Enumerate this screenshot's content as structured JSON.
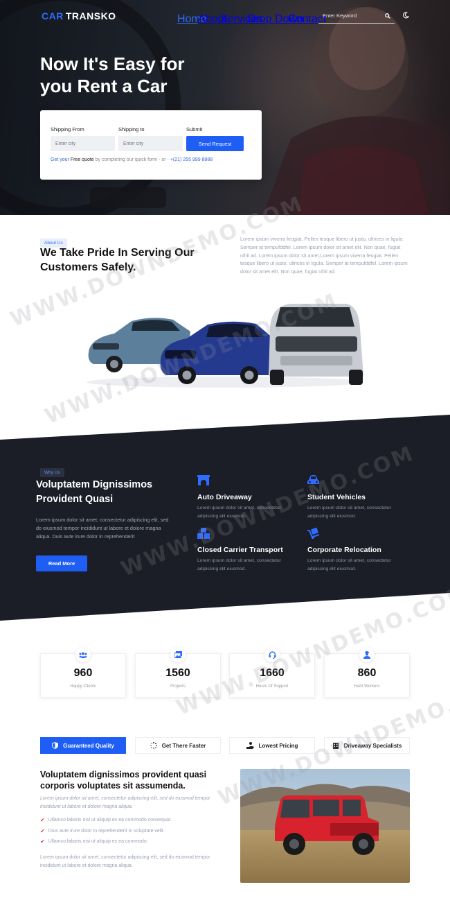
{
  "brand": {
    "mark": "CAR",
    "name": "TRANSKO"
  },
  "nav": {
    "items": [
      "Home",
      "About",
      "Services",
      "Drop Down",
      "Contact"
    ],
    "active_color": "#2f6bff"
  },
  "search": {
    "placeholder": "Enter Keyword"
  },
  "hero": {
    "title": "Now It's Easy for you Rent a Car",
    "form": {
      "from_label": "Shipping From",
      "from_placeholder": "Enter city",
      "to_label": "Shipping to",
      "to_placeholder": "Enter city",
      "submit_label": "Submit",
      "button": "Send Request",
      "note_prefix": "Get your",
      "note_free": "Free",
      "note_quote": "quote",
      "note_middle": "by completing our quick form - or -",
      "phone": "+(21) 255 999 8888"
    }
  },
  "about": {
    "tag": "About Us",
    "title": "We Take Pride In Serving Our Customers Safely.",
    "text": "Lorem ipsum viverra feugiat. Pellen tesque libero ut justo, ultrices in ligula. Semper at tempufddfel. Lorem ipsum dolor sit amet elit. Non quae, fugiat nihil ad. Lorem ipsum dolor sit amet.Lorem ipsum viverra feugiat. Pellen tesque libero ut justo, ultrices in ligula. Semper at tempufddfel. Lorem ipsum dolor sit amet elit. Non quae, fugiat nihil ad."
  },
  "why": {
    "tag": "Why Us",
    "title": "Voluptatem Dignissimos Provident Quasi",
    "text": "Lorem ipsum dolor sit amet, consectetur adipiscing elit, sed do eiusmod tempor incididunt ut labore et dolore magna aliqua. Duis aute irure dolor in reprehenderit",
    "button": "Read More",
    "features": [
      {
        "icon": "bridge-icon",
        "title": "Auto Driveaway",
        "text": "Lorem ipsum dolor sit amet, consectetur adipiscing elit eiusmod."
      },
      {
        "icon": "car-icon",
        "title": "Student Vehicles",
        "text": "Lorem ipsum dolor sit amet, consectetur adipiscing elit eiusmod."
      },
      {
        "icon": "boxes-icon",
        "title": "Closed Carrier Transport",
        "text": "Lorem ipsum dolor sit amet, consectetur adipiscing elit eiusmod."
      },
      {
        "icon": "dolly-icon",
        "title": "Corporate Relocation",
        "text": "Lorem ipsum dolor sit amet, consectetur adipiscing elit eiusmod."
      }
    ]
  },
  "stats": [
    {
      "icon": "users-icon",
      "value": "960",
      "label": "Happy Clients"
    },
    {
      "icon": "images-icon",
      "value": "1560",
      "label": "Projects"
    },
    {
      "icon": "headset-icon",
      "value": "1660",
      "label": "Hours Of Support"
    },
    {
      "icon": "worker-icon",
      "value": "860",
      "label": "Hard Workers"
    }
  ],
  "tabs": [
    {
      "icon": "shield-icon",
      "label": "Guaranteed Quality",
      "active": true
    },
    {
      "icon": "spinner-icon",
      "label": "Get There Faster"
    },
    {
      "icon": "hand-coin-icon",
      "label": "Lowest Pricing"
    },
    {
      "icon": "building-icon",
      "label": "Driveaway Specialists"
    }
  ],
  "tab_content": {
    "title": "Voluptatem dignissimos provident quasi corporis voluptates sit assumenda.",
    "italic": "Lorem ipsum dolor sit amet, consectetur adipiscing elit, sed do eiusmod tempor incididunt ut labore et dolore magna aliqua.",
    "list": [
      "Ullamco laboris nisi ut aliquip ex ea commodo consequat.",
      "Duis aute irure dolor in reprehenderit in voluptate velit.",
      "Ullamco laboris nisi ut aliquip ex ea commodo."
    ],
    "bottom": "Lorem ipsum dolor sit amet, consectetur adipiscing elit, sed do eiusmod tempor incididunt ut labore et dolore magna aliqua."
  },
  "watermark": "WWW.DOWNDEMO.COM",
  "colors": {
    "accent": "#1f5ef5",
    "dark": "#1b1e26",
    "check": "#e0364d"
  }
}
